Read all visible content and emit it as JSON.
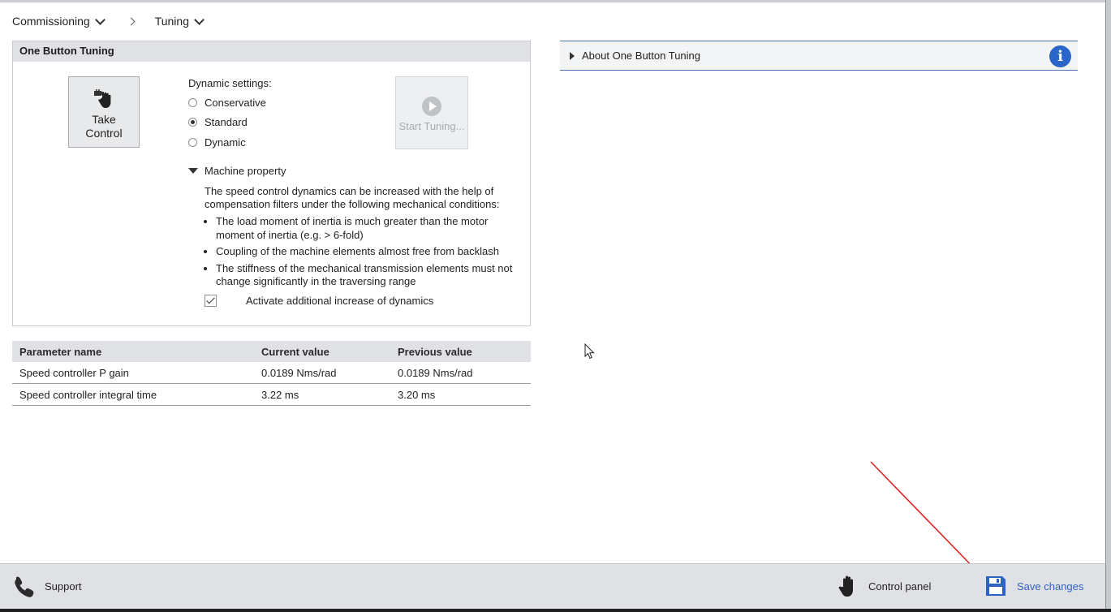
{
  "breadcrumb": {
    "item1": "Commissioning",
    "item2": "Tuning"
  },
  "obt": {
    "title": "One Button Tuning",
    "take_control": {
      "line1": "Take",
      "line2": "Control"
    },
    "dynamic_settings_label": "Dynamic settings:",
    "options": [
      "Conservative",
      "Standard",
      "Dynamic"
    ],
    "selected_option": "Standard",
    "start_tuning": "Start Tuning...",
    "machine_property": {
      "label": "Machine property",
      "intro": "The speed control dynamics can be increased with the help of compensation filters under the following mechanical conditions:",
      "conditions": [
        "The load moment of inertia is much greater than the motor moment of inertia (e.g. > 6-fold)",
        "Coupling of the machine elements almost free from backlash",
        "The stiffness of the mechanical transmission elements must not change significantly in the traversing range"
      ],
      "checkbox_label": "Activate additional increase of dynamics",
      "checkbox_checked": true
    }
  },
  "table": {
    "headers": [
      "Parameter name",
      "Current value",
      "Previous value"
    ],
    "rows": [
      [
        "Speed controller P gain",
        "0.0189 Nms/rad",
        "0.0189 Nms/rad"
      ],
      [
        "Speed controller integral time",
        "3.22 ms",
        "3.20 ms"
      ]
    ]
  },
  "about": {
    "label": "About One Button Tuning",
    "icon": "info-icon"
  },
  "footer": {
    "support": "Support",
    "control_panel": "Control panel",
    "save_changes": "Save changes"
  },
  "colors": {
    "accent_blue": "#2a66c9",
    "annotation_red": "#e02020",
    "panel_gray": "#dfe1e5"
  }
}
